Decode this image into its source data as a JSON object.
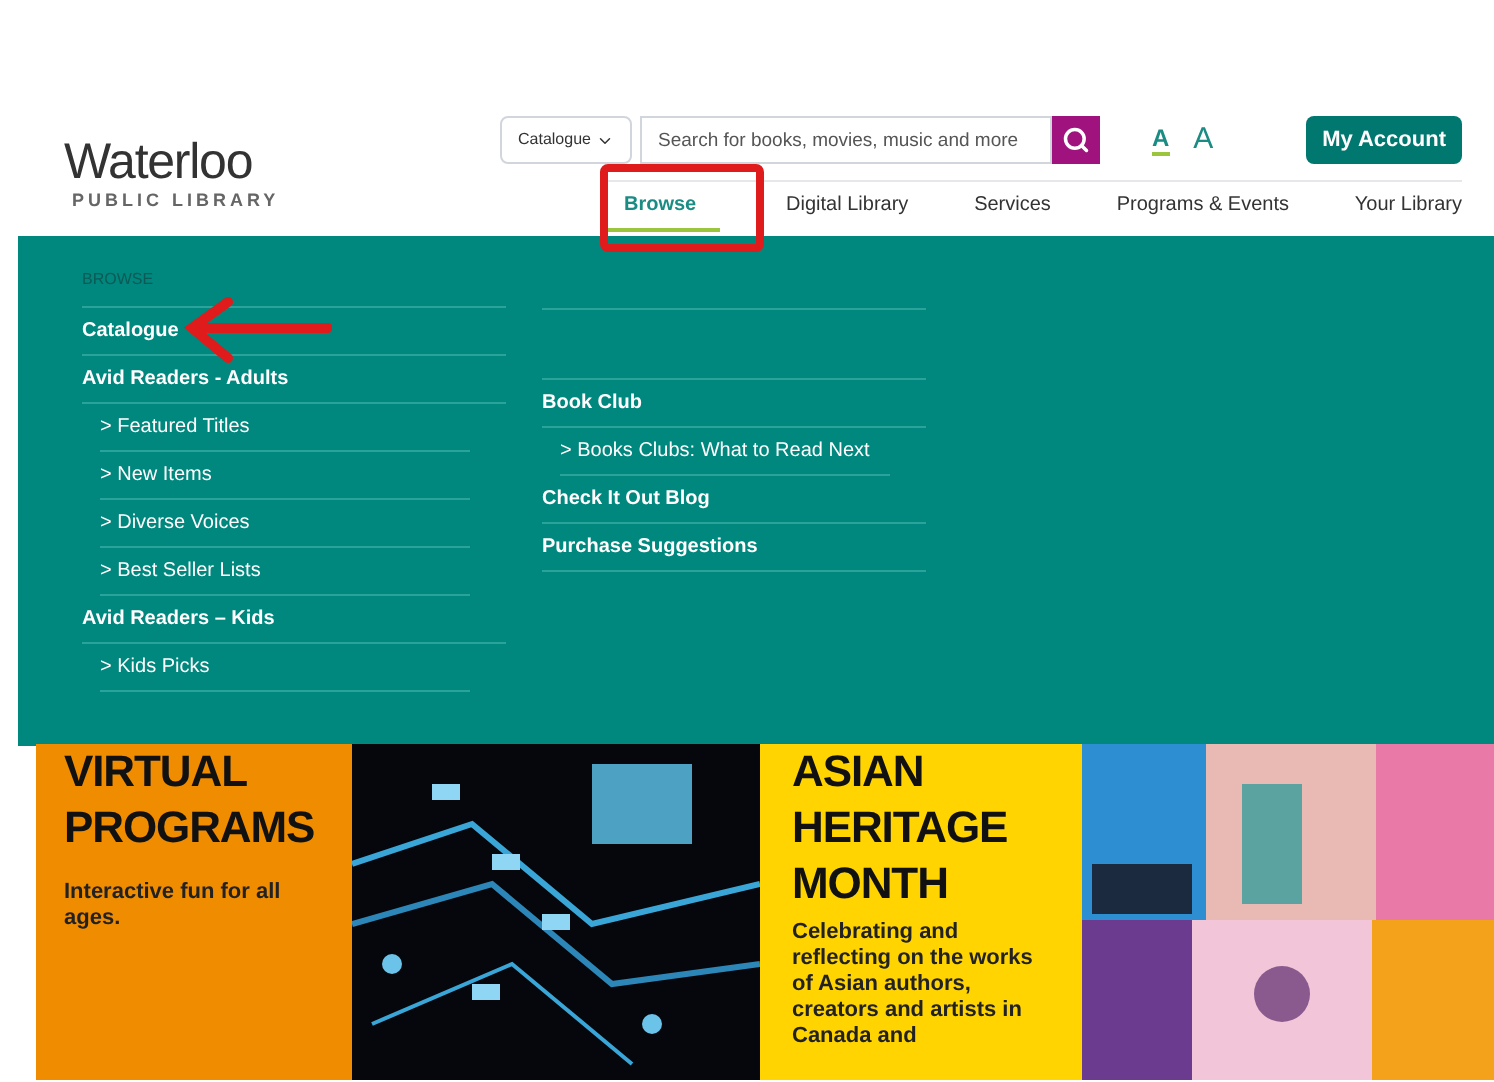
{
  "logo": {
    "name": "Waterloo",
    "subtitle": "PUBLIC LIBRARY"
  },
  "search": {
    "scope": "Catalogue",
    "placeholder": "Search for books, movies, music and more"
  },
  "text_size": [
    "A",
    "A"
  ],
  "account_button": "My Account",
  "nav": [
    {
      "label": "Browse",
      "selected": true
    },
    {
      "label": "Digital Library",
      "selected": false
    },
    {
      "label": "Services",
      "selected": false
    },
    {
      "label": "Programs & Events",
      "selected": false
    },
    {
      "label": "Your Library",
      "selected": false
    }
  ],
  "menu": {
    "heading": "BROWSE",
    "column_1": [
      {
        "label": "Catalogue",
        "kind": "main"
      },
      {
        "label": "Avid Readers - Adults",
        "kind": "main"
      },
      {
        "label": "> Featured Titles",
        "kind": "sub"
      },
      {
        "label": "> New Items",
        "kind": "sub"
      },
      {
        "label": "> Diverse Voices",
        "kind": "sub"
      },
      {
        "label": "> Best Seller Lists",
        "kind": "sub"
      },
      {
        "label": "Avid Readers – Kids",
        "kind": "main"
      },
      {
        "label": "> Kids Picks",
        "kind": "sub"
      }
    ],
    "column_2": [
      {
        "label": "Book Club",
        "kind": "main"
      },
      {
        "label": "> Books Clubs: What to Read Next",
        "kind": "sub"
      },
      {
        "label": "Check It Out Blog",
        "kind": "main"
      },
      {
        "label": "Purchase Suggestions",
        "kind": "main"
      }
    ]
  },
  "banners": [
    {
      "title": "VIRTUAL PROGRAMS",
      "text": "Interactive fun for all ages."
    },
    {
      "title": "ASIAN HERITAGE MONTH",
      "text": "Celebrating and reflecting on the works of Asian authors, creators and artists in Canada and"
    }
  ]
}
